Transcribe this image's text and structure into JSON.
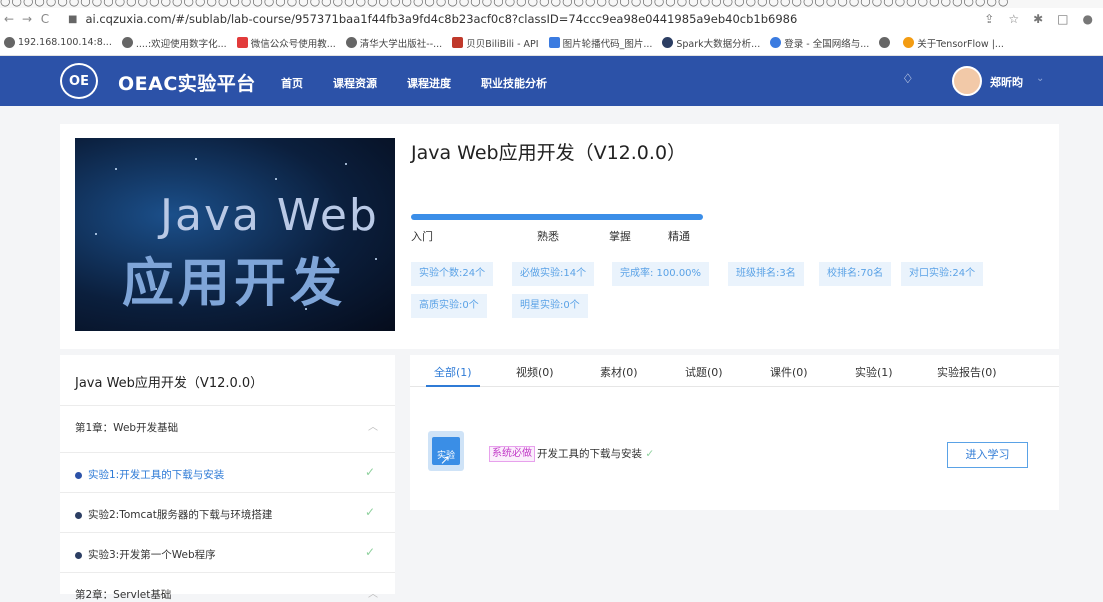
{
  "browser": {
    "url": "ai.cqzuxia.com/#/sublab/lab-course/957371baa1f44fb3a9fd4c8b23acf0c8?classID=74ccc9ea98e0441985a9eb40cb1b6986",
    "bookmarks": [
      "192.168.100.14:8...",
      "....:欢迎使用数字化...",
      "微信公众号使用教...",
      "清华大学出版社--...",
      "贝贝BiliBili - API",
      "图片轮播代码_图片...",
      "Spark大数据分析...",
      "登录 - 全国网络与...",
      "",
      "关于TensorFlow |..."
    ]
  },
  "header": {
    "logo_mark": "OE",
    "logo_text": "OEAC实验平台",
    "nav": [
      "首页",
      "课程资源",
      "课程进度",
      "职业技能分析"
    ],
    "user_name": "郑昕昀"
  },
  "course": {
    "banner_line1": "Java Web",
    "banner_line2": "应用开发",
    "title": "Java Web应用开发（V12.0.0）",
    "levels": [
      "入门",
      "熟悉",
      "掌握",
      "精通"
    ],
    "tags": [
      "实验个数:24个",
      "必做实验:14个",
      "完成率: 100.00%",
      "班级排名:3名",
      "校排名:70名",
      "对口实验:24个",
      "高质实验:0个",
      "明星实验:0个"
    ]
  },
  "sidebar": {
    "title": "Java Web应用开发（V12.0.0）",
    "chapter1": "第1章：Web开发基础",
    "items": [
      "实验1:开发工具的下载与安装",
      "实验2:Tomcat服务器的下载与环境搭建",
      "实验3:开发第一个Web程序"
    ],
    "chapter2": "第2章：Servlet基础"
  },
  "main": {
    "tabs": [
      "全部(1)",
      "视频(0)",
      "素材(0)",
      "试题(0)",
      "课件(0)",
      "实验(1)",
      "实验报告(0)"
    ],
    "item": {
      "icon_label": "实验",
      "badge": "系统必做",
      "name": "开发工具的下载与安装",
      "button": "进入学习"
    }
  },
  "colors": {
    "header_bg": "#2c52a8",
    "accent": "#2f7bd6",
    "tag_bg": "#eaf3fc",
    "badge": "#c23ac8",
    "check": "#8fd19e"
  }
}
